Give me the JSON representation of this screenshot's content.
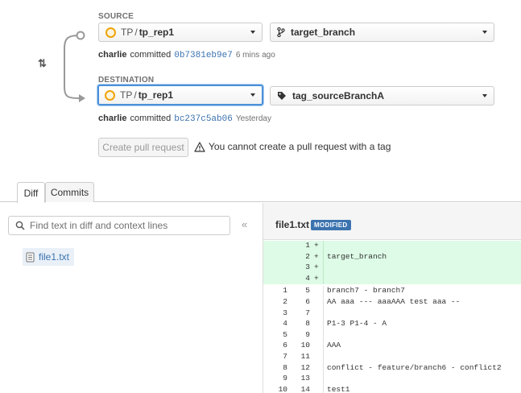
{
  "source": {
    "label": "SOURCE",
    "repo_project": "TP",
    "repo_separator": "/",
    "repo_name": "tp_rep1",
    "branch": "target_branch",
    "commit": {
      "author": "charlie",
      "verb": "committed",
      "hash": "0b7381eb9e7",
      "when": "6 mins ago"
    }
  },
  "swap_label": "⇅",
  "destination": {
    "label": "DESTINATION",
    "repo_project": "TP",
    "repo_separator": "/",
    "repo_name": "tp_rep1",
    "branch": "tag_sourceBranchA",
    "commit": {
      "author": "charlie",
      "verb": "committed",
      "hash": "bc237c5ab06",
      "when": "Yesterday"
    }
  },
  "actions": {
    "create_label": "Create pull request",
    "warning": "You cannot create a pull request with a tag"
  },
  "tabs": [
    {
      "label": "Diff",
      "active": true
    },
    {
      "label": "Commits",
      "active": false
    }
  ],
  "file_tree": {
    "search_placeholder": "Find text in diff and context lines",
    "collapse_label": "«",
    "files": [
      "file1.txt"
    ]
  },
  "diff": {
    "file_name": "file1.txt",
    "badge": "MODIFIED",
    "lines": [
      {
        "old": "",
        "new": "1",
        "mark": "+",
        "text": "",
        "type": "added"
      },
      {
        "old": "",
        "new": "2",
        "mark": "+",
        "text": "target_branch",
        "type": "added"
      },
      {
        "old": "",
        "new": "3",
        "mark": "+",
        "text": "",
        "type": "added"
      },
      {
        "old": "",
        "new": "4",
        "mark": "+",
        "text": "",
        "type": "added"
      },
      {
        "old": "1",
        "new": "5",
        "mark": "",
        "text": "branch7 - branch7",
        "type": "context"
      },
      {
        "old": "2",
        "new": "6",
        "mark": "",
        "text": "AA aaa --- aaaAAA test aaa --",
        "type": "context"
      },
      {
        "old": "3",
        "new": "7",
        "mark": "",
        "text": "",
        "type": "context"
      },
      {
        "old": "4",
        "new": "8",
        "mark": "",
        "text": "P1-3 P1-4 - A",
        "type": "context"
      },
      {
        "old": "5",
        "new": "9",
        "mark": "",
        "text": "",
        "type": "context"
      },
      {
        "old": "6",
        "new": "10",
        "mark": "",
        "text": "AAA",
        "type": "context"
      },
      {
        "old": "7",
        "new": "11",
        "mark": "",
        "text": "",
        "type": "context"
      },
      {
        "old": "8",
        "new": "12",
        "mark": "",
        "text": "conflict - feature/branch6 - conflict2",
        "type": "context"
      },
      {
        "old": "9",
        "new": "13",
        "mark": "",
        "text": "",
        "type": "context"
      },
      {
        "old": "10",
        "new": "14",
        "mark": "",
        "text": "test1",
        "type": "context"
      }
    ]
  }
}
